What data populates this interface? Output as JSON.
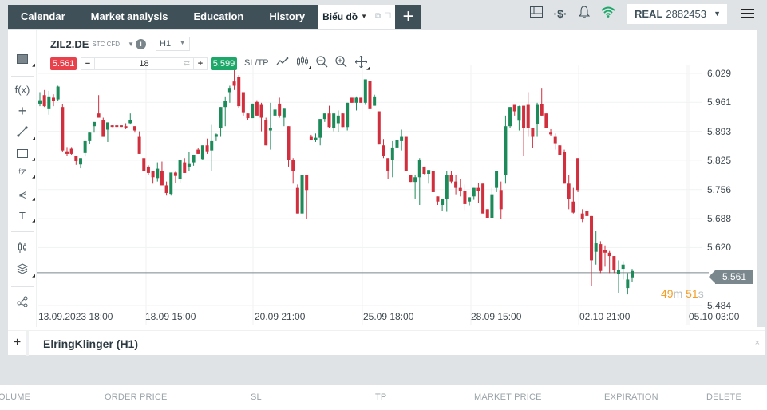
{
  "tabs": [
    {
      "label": "Calendar"
    },
    {
      "label": "Market analysis"
    },
    {
      "label": "Education"
    },
    {
      "label": "History"
    }
  ],
  "active_tab": {
    "label": "Biểu đồ"
  },
  "account": {
    "type": "REAL",
    "number": "2882453"
  },
  "icons": {
    "layout": "layout-icon",
    "currency": "dollar-signal-icon",
    "bell": "bell-icon",
    "wifi": "wifi-icon",
    "menu": "hamburger-icon"
  },
  "colors": {
    "up": "#1d8a5a",
    "down": "#d12f3d",
    "sell": "#e8414c",
    "buy": "#1da86a",
    "wifi": "#1da86a",
    "countdown": "#f29f2a",
    "price_line": "#7a878d"
  },
  "instrument": {
    "symbol": "ZIL2.DE",
    "type": "STC CFD",
    "timeframe": "H1"
  },
  "trade": {
    "sell_price": "5.561",
    "buy_price": "5.599",
    "quantity": "18",
    "minus": "−",
    "plus": "+",
    "sltp": "SL/TP"
  },
  "chart_tools": [
    "line-chart-icon",
    "candlestick-icon",
    "zoom-out-icon",
    "zoom-in-icon",
    "crosshair-move-icon"
  ],
  "left_tools": [
    "chart-type-icon",
    "indicator-fx-icon",
    "crosshair-icon",
    "trend-line-icon",
    "rectangle-icon",
    "fibonacci-icon",
    "pitchfork-icon",
    "text-icon",
    "candles-icon",
    "layers-icon",
    "share-icon"
  ],
  "fx_label": "f(x)",
  "countdown": {
    "min": "49",
    "min_unit": "m",
    "sec": "51",
    "sec_unit": "s"
  },
  "current_price_label": "5.561",
  "indicator_panel": {
    "title": "ElringKlinger (H1)",
    "plus": "+",
    "close": "×"
  },
  "orders_header": [
    "OLUME",
    "ORDER PRICE",
    "SL",
    "TP",
    "MARKET PRICE",
    "EXPIRATION",
    "DELETE"
  ],
  "chart_data": {
    "type": "candlestick",
    "title": "ZIL2.DE H1",
    "ylim": [
      5.484,
      6.029
    ],
    "yticks": [
      "6.029",
      "5.961",
      "5.893",
      "5.825",
      "5.756",
      "5.688",
      "5.620",
      "5.484"
    ],
    "xticks": [
      "13.09.2023 18:00",
      "18.09 15:00",
      "20.09 21:00",
      "25.09 18:00",
      "28.09 15:00",
      "02.10 21:00",
      "05.10 03:00"
    ],
    "current_price": 5.561,
    "candles": [
      [
        5.958,
        5.985,
        5.952,
        5.966
      ],
      [
        5.978,
        5.99,
        5.95,
        5.952
      ],
      [
        5.945,
        5.988,
        5.932,
        5.975
      ],
      [
        5.972,
        5.98,
        5.952,
        5.964
      ],
      [
        5.968,
        6.0,
        5.965,
        5.998
      ],
      [
        5.95,
        5.957,
        5.845,
        5.848
      ],
      [
        5.846,
        5.856,
        5.836,
        5.84
      ],
      [
        5.852,
        5.856,
        5.838,
        5.84
      ],
      [
        5.836,
        5.836,
        5.814,
        5.823
      ],
      [
        5.815,
        5.825,
        5.806,
        5.83
      ],
      [
        5.842,
        5.858,
        5.834,
        5.87
      ],
      [
        5.87,
        5.878,
        5.864,
        5.89
      ],
      [
        5.905,
        5.915,
        5.89,
        5.915
      ],
      [
        5.935,
        5.978,
        5.925,
        5.925
      ],
      [
        5.92,
        5.925,
        5.88,
        5.88
      ],
      [
        5.897,
        5.905,
        5.868,
        5.914
      ],
      [
        5.907,
        5.907,
        5.903,
        5.905
      ],
      [
        5.907,
        5.907,
        5.903,
        5.905
      ],
      [
        5.907,
        5.907,
        5.903,
        5.905
      ],
      [
        5.905,
        5.912,
        5.898,
        5.9
      ],
      [
        5.912,
        5.935,
        5.909,
        5.92
      ],
      [
        5.905,
        5.905,
        5.89,
        5.895
      ],
      [
        5.88,
        5.893,
        5.84,
        5.84
      ],
      [
        5.83,
        5.83,
        5.8,
        5.8
      ],
      [
        5.81,
        5.813,
        5.79,
        5.795
      ],
      [
        5.8,
        5.8,
        5.77,
        5.785
      ],
      [
        5.783,
        5.82,
        5.775,
        5.805
      ],
      [
        5.8,
        5.822,
        5.78,
        5.766
      ],
      [
        5.766,
        5.775,
        5.742,
        5.748
      ],
      [
        5.746,
        5.786,
        5.742,
        5.796
      ],
      [
        5.796,
        5.798,
        5.772,
        5.788
      ],
      [
        5.78,
        5.82,
        5.772,
        5.826
      ],
      [
        5.82,
        5.83,
        5.8,
        5.795
      ],
      [
        5.81,
        5.844,
        5.8,
        5.818
      ],
      [
        5.82,
        5.83,
        5.812,
        5.838
      ],
      [
        5.85,
        5.853,
        5.84,
        5.84
      ],
      [
        5.828,
        5.858,
        5.825,
        5.86
      ],
      [
        5.86,
        5.876,
        5.84,
        5.846
      ],
      [
        5.848,
        5.908,
        5.8,
        5.87
      ],
      [
        5.88,
        5.888,
        5.87,
        5.886
      ],
      [
        5.9,
        5.912,
        5.88,
        5.95
      ],
      [
        5.95,
        5.975,
        5.905,
        5.965
      ],
      [
        5.985,
        6.0,
        5.96,
        5.995
      ],
      [
        6.01,
        6.045,
        5.99,
        6.0
      ],
      [
        6.02,
        6.025,
        5.948,
        5.952
      ],
      [
        5.985,
        5.985,
        5.93,
        5.936
      ],
      [
        5.935,
        5.935,
        5.92,
        5.924
      ],
      [
        5.924,
        5.956,
        5.924,
        5.958
      ],
      [
        5.962,
        5.966,
        5.93,
        5.93
      ],
      [
        5.955,
        5.96,
        5.893,
        5.925
      ],
      [
        5.92,
        5.925,
        5.86,
        5.86
      ],
      [
        5.895,
        5.96,
        5.85,
        5.9
      ],
      [
        5.93,
        5.958,
        5.927,
        5.944
      ],
      [
        5.958,
        5.972,
        5.925,
        5.93
      ],
      [
        5.925,
        5.93,
        5.905,
        5.946
      ],
      [
        5.905,
        5.905,
        5.81,
        5.826
      ],
      [
        5.825,
        5.83,
        5.77,
        5.8
      ],
      [
        5.76,
        5.768,
        5.7,
        5.7
      ],
      [
        5.7,
        5.76,
        5.69,
        5.79
      ],
      [
        5.79,
        5.79,
        5.688,
        5.755
      ],
      [
        5.88,
        5.885,
        5.872,
        5.872
      ],
      [
        5.872,
        5.888,
        5.868,
        5.878
      ],
      [
        5.878,
        5.918,
        5.86,
        5.922
      ],
      [
        5.922,
        5.935,
        5.915,
        5.935
      ],
      [
        5.935,
        5.953,
        5.9,
        5.903
      ],
      [
        5.9,
        5.917,
        5.893,
        5.935
      ],
      [
        5.912,
        5.942,
        5.892,
        5.93
      ],
      [
        5.935,
        5.935,
        5.903,
        5.903
      ],
      [
        5.903,
        5.96,
        5.895,
        5.96
      ],
      [
        5.972,
        5.972,
        5.96,
        5.96
      ],
      [
        5.96,
        5.975,
        5.942,
        5.972
      ],
      [
        5.972,
        5.972,
        5.96,
        5.96
      ],
      [
        5.96,
        6.015,
        5.955,
        6.015
      ],
      [
        6.012,
        6.012,
        5.935,
        5.945
      ],
      [
        5.953,
        5.979,
        5.962,
        5.975
      ],
      [
        5.94,
        5.94,
        5.862,
        5.862
      ],
      [
        5.86,
        5.875,
        5.83,
        5.835
      ],
      [
        5.83,
        5.83,
        5.78,
        5.8
      ],
      [
        5.825,
        5.87,
        5.785,
        5.855
      ],
      [
        5.855,
        5.872,
        5.86,
        5.872
      ],
      [
        5.87,
        5.897,
        5.848,
        5.88
      ],
      [
        5.88,
        5.88,
        5.8,
        5.8
      ],
      [
        5.79,
        5.79,
        5.774,
        5.774
      ],
      [
        5.774,
        5.79,
        5.735,
        5.785
      ],
      [
        5.785,
        5.83,
        5.72,
        5.826
      ],
      [
        5.81,
        5.81,
        5.792,
        5.793
      ],
      [
        5.793,
        5.801,
        5.77,
        5.802
      ],
      [
        5.8,
        5.8,
        5.75,
        5.75
      ],
      [
        5.74,
        5.74,
        5.72,
        5.728
      ],
      [
        5.72,
        5.735,
        5.706,
        5.735
      ],
      [
        5.735,
        5.8,
        5.704,
        5.79
      ],
      [
        5.79,
        5.8,
        5.77,
        5.775
      ],
      [
        5.775,
        5.79,
        5.745,
        5.76
      ],
      [
        5.76,
        5.78,
        5.74,
        5.752
      ],
      [
        5.752,
        5.768,
        5.708,
        5.722
      ],
      [
        5.728,
        5.738,
        5.719,
        5.738
      ],
      [
        5.74,
        5.76,
        5.732,
        5.76
      ],
      [
        5.76,
        5.772,
        5.724,
        5.752
      ],
      [
        5.77,
        5.77,
        5.7,
        5.7
      ],
      [
        5.71,
        5.71,
        5.69,
        5.69
      ],
      [
        5.69,
        5.76,
        5.69,
        5.745
      ],
      [
        5.76,
        5.8,
        5.75,
        5.8
      ],
      [
        5.755,
        5.775,
        5.688,
        5.71
      ],
      [
        5.79,
        5.93,
        5.77,
        5.905
      ],
      [
        5.905,
        5.95,
        5.9,
        5.95
      ],
      [
        5.955,
        5.95,
        5.93,
        5.94
      ],
      [
        5.918,
        5.953,
        5.895,
        5.952
      ],
      [
        5.953,
        5.953,
        5.836,
        5.9
      ],
      [
        5.955,
        5.985,
        5.88,
        5.9
      ],
      [
        5.9,
        5.9,
        5.853,
        5.88
      ],
      [
        5.91,
        5.96,
        5.88,
        5.955
      ],
      [
        5.956,
        5.995,
        5.928,
        5.93
      ],
      [
        5.935,
        5.935,
        5.9,
        5.9
      ],
      [
        5.89,
        5.898,
        5.883,
        5.886
      ],
      [
        5.88,
        5.888,
        5.85,
        5.865
      ],
      [
        5.86,
        5.86,
        5.838,
        5.838
      ],
      [
        5.845,
        5.85,
        5.77,
        5.77
      ],
      [
        5.77,
        5.79,
        5.71,
        5.735
      ],
      [
        5.728,
        5.76,
        5.7,
        5.702
      ],
      [
        5.83,
        5.83,
        5.75,
        5.755
      ],
      [
        5.7,
        5.71,
        5.68,
        5.687
      ],
      [
        5.706,
        5.706,
        5.694,
        5.694
      ],
      [
        5.694,
        5.694,
        5.53,
        5.59
      ],
      [
        5.61,
        5.66,
        5.58,
        5.63
      ],
      [
        5.628,
        5.635,
        5.56,
        5.565
      ],
      [
        5.615,
        5.625,
        5.575,
        5.608
      ],
      [
        5.608,
        5.612,
        5.56,
        5.6
      ],
      [
        5.6,
        5.6,
        5.56,
        5.568
      ],
      [
        5.558,
        5.59,
        5.514,
        5.567
      ],
      [
        5.57,
        5.588,
        5.545,
        5.58
      ],
      [
        5.525,
        5.56,
        5.51,
        5.545
      ],
      [
        5.55,
        5.57,
        5.54,
        5.565
      ]
    ]
  }
}
